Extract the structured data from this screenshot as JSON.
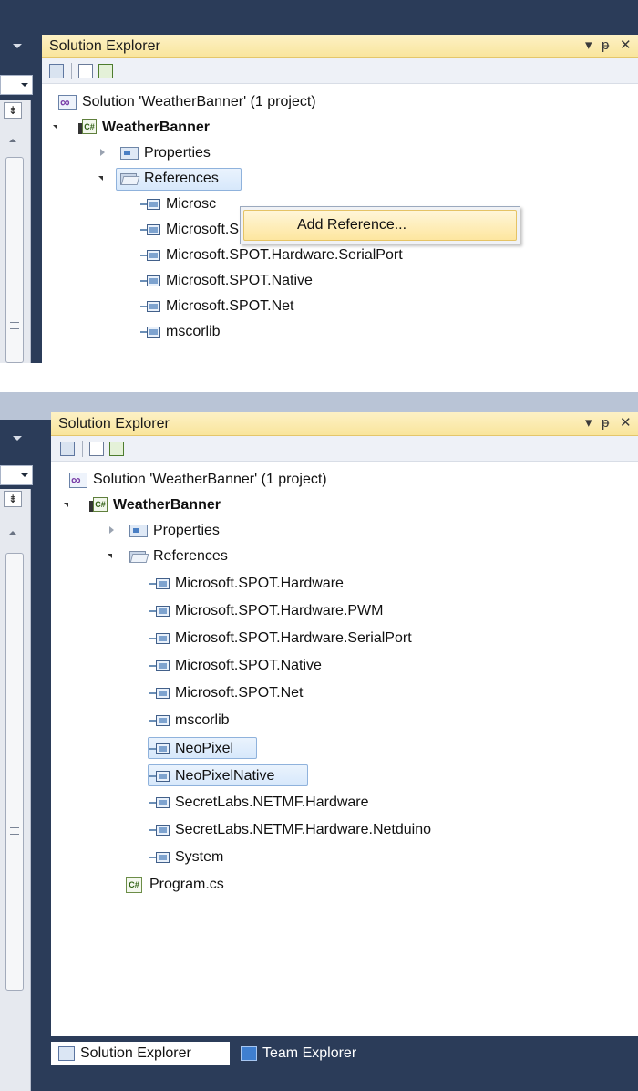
{
  "panel_top": {
    "window_title": "Solution Explorer",
    "title_buttons": {
      "dropdown": "▾",
      "pin": "ᵽ",
      "close": "✕"
    },
    "tree": {
      "solution": "Solution 'WeatherBanner' (1 project)",
      "project": "WeatherBanner",
      "properties": "Properties",
      "references": "References",
      "refs": [
        "Microsc",
        "Microsoft.SPOT.Hardware.PWM",
        "Microsoft.SPOT.Hardware.SerialPort",
        "Microsoft.SPOT.Native",
        "Microsoft.SPOT.Net",
        "mscorlib"
      ]
    },
    "context_menu": {
      "item": "Add Reference..."
    }
  },
  "panel_bottom": {
    "window_title": "Solution Explorer",
    "title_buttons": {
      "dropdown": "▾",
      "pin": "ᵽ",
      "close": "✕"
    },
    "tree": {
      "solution": "Solution 'WeatherBanner' (1 project)",
      "project": "WeatherBanner",
      "properties": "Properties",
      "references": "References",
      "refs": [
        "Microsoft.SPOT.Hardware",
        "Microsoft.SPOT.Hardware.PWM",
        "Microsoft.SPOT.Hardware.SerialPort",
        "Microsoft.SPOT.Native",
        "Microsoft.SPOT.Net",
        "mscorlib",
        "NeoPixel",
        "NeoPixelNative",
        "SecretLabs.NETMF.Hardware",
        "SecretLabs.NETMF.Hardware.Netduino",
        "System"
      ],
      "program": "Program.cs"
    },
    "tabs": {
      "solution_explorer": "Solution Explorer",
      "team_explorer": "Team Explorer"
    }
  },
  "colors": {
    "frame": "#2b3c59",
    "title_gold": "#f9e59c",
    "selection": "#d7e8fb"
  }
}
